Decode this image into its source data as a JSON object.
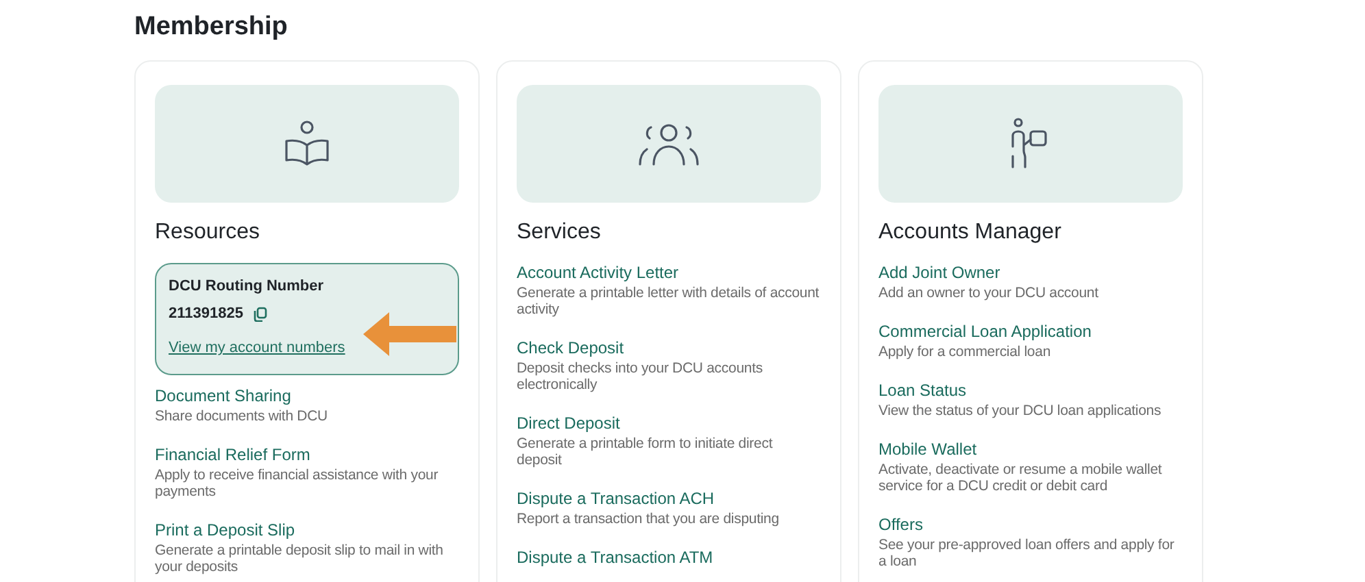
{
  "heading": "Membership",
  "cards": [
    {
      "kind": "reader",
      "title": "Resources",
      "routing": {
        "label": "DCU Routing Number",
        "number": "211391825",
        "link": "View my account numbers"
      },
      "items": [
        {
          "title": "Document Sharing",
          "description": "Share documents with DCU"
        },
        {
          "title": "Financial Relief Form",
          "description": "Apply to receive financial assistance with your payments"
        },
        {
          "title": "Print a Deposit Slip",
          "description": "Generate a printable deposit slip to mail in with your deposits"
        }
      ]
    },
    {
      "kind": "people",
      "title": "Services",
      "items": [
        {
          "title": "Account Activity Letter",
          "description": "Generate a printable letter with details of account activity"
        },
        {
          "title": "Check Deposit",
          "description": "Deposit checks into your DCU accounts electronically"
        },
        {
          "title": "Direct Deposit",
          "description": "Generate a printable form to initiate direct deposit"
        },
        {
          "title": "Dispute a Transaction ACH",
          "description": "Report a transaction that you are disputing"
        },
        {
          "title": "Dispute a Transaction ATM"
        }
      ]
    },
    {
      "kind": "presenter",
      "title": "Accounts Manager",
      "items": [
        {
          "title": "Add Joint Owner",
          "description": "Add an owner to your DCU account"
        },
        {
          "title": "Commercial Loan Application",
          "description": "Apply for a commercial loan"
        },
        {
          "title": "Loan Status",
          "description": "View the status of your DCU loan applications"
        },
        {
          "title": "Mobile Wallet",
          "description": "Activate, deactivate or resume a mobile wallet service for a DCU credit or debit card"
        },
        {
          "title": "Offers",
          "description": "See your pre-approved loan offers and apply for a loan"
        }
      ]
    }
  ]
}
